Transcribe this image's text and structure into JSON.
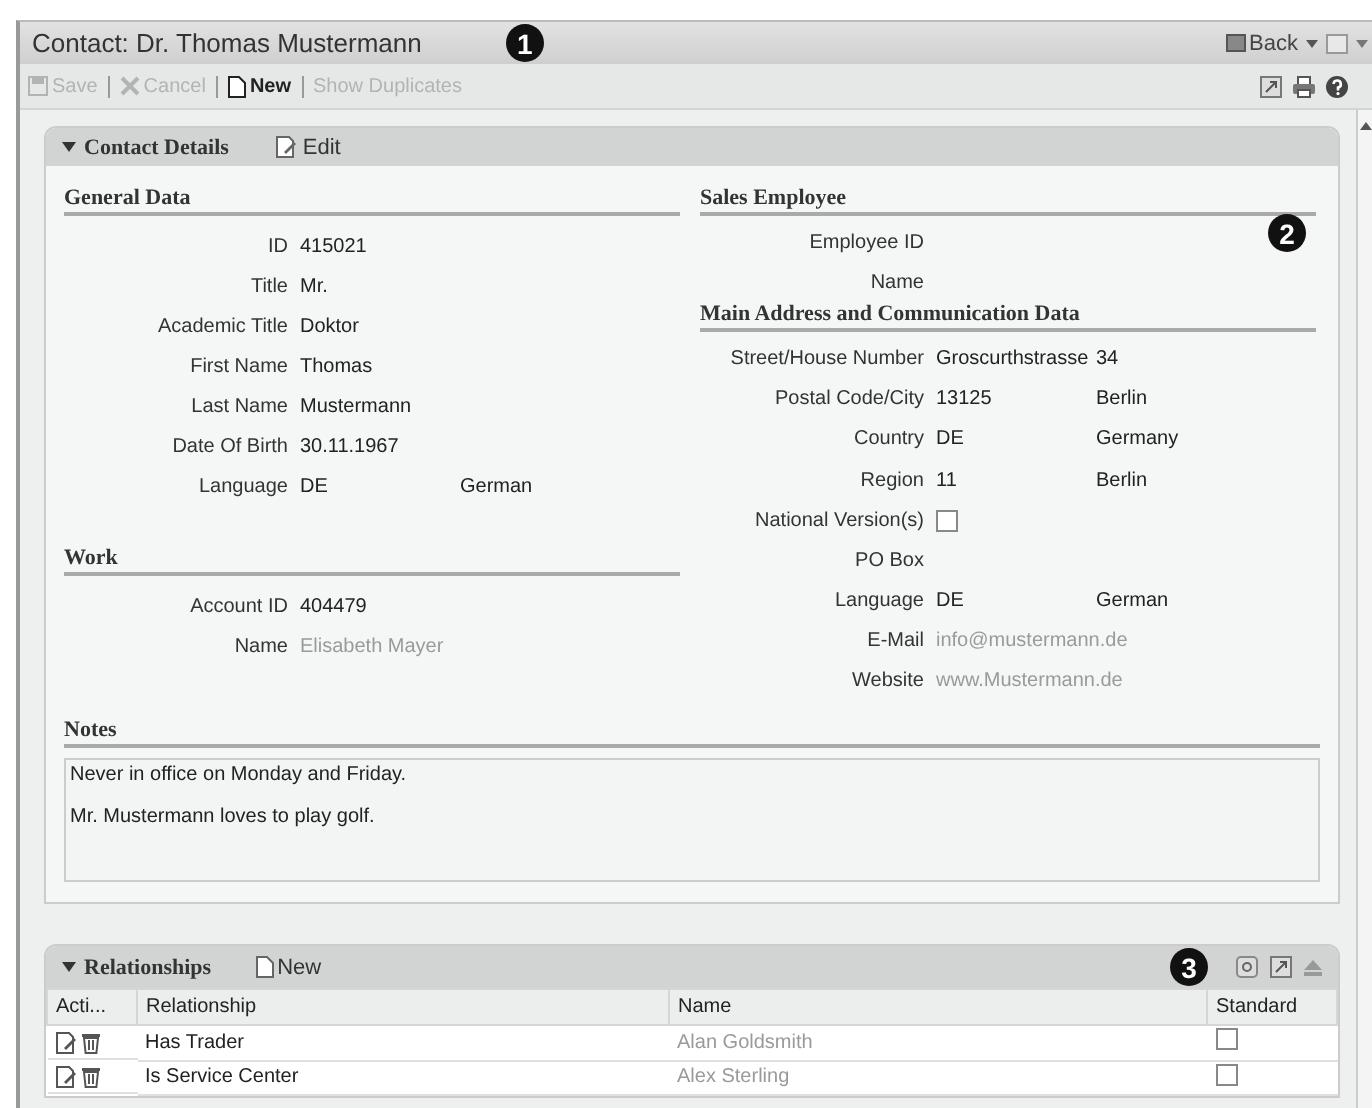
{
  "window": {
    "title": "Contact: Dr. Thomas Mustermann",
    "callout": "1",
    "back": "Back"
  },
  "toolbar": [
    {
      "label": "Save",
      "kind": "save",
      "disabled": true
    },
    {
      "label": "Cancel",
      "kind": "cancel",
      "disabled": true
    },
    {
      "label": "New",
      "kind": "new",
      "disabled": false
    },
    {
      "label": "Show Duplicates",
      "kind": "plain",
      "disabled": true
    }
  ],
  "contact_details": {
    "title": "Contact Details",
    "expanded": true,
    "edit": "Edit",
    "callout": "2",
    "general": {
      "heading": "General Data",
      "fields": [
        {
          "label": "ID",
          "value": "415021"
        },
        {
          "label": "Title",
          "value": "Mr."
        },
        {
          "label": "Academic Title",
          "value": "Doktor"
        },
        {
          "label": "First Name",
          "value": "Thomas"
        },
        {
          "label": "Last Name",
          "value": "Mustermann"
        },
        {
          "label": "Date Of Birth",
          "value": "30.11.1967"
        },
        {
          "label": "Language",
          "value": "DE",
          "value_2": "German"
        }
      ]
    },
    "work": {
      "heading": "Work",
      "fields": [
        {
          "label": "Account ID",
          "value": "404479"
        },
        {
          "label": "Name",
          "value": "Elisabeth Mayer",
          "kind": "link"
        }
      ]
    },
    "sales": {
      "heading": "Sales Employee",
      "fields": [
        {
          "label": "Employee ID"
        },
        {
          "label": "Name"
        }
      ]
    },
    "address": {
      "heading": "Main Address and Communication Data",
      "fields": [
        {
          "label": "Street/House Number",
          "value": "Groscurthstrasse",
          "value_2": "34"
        },
        {
          "label": "Postal Code/City",
          "value": "13125",
          "value_2": "Berlin"
        },
        {
          "label": "Country",
          "value": "DE",
          "value_2": "Germany"
        },
        {
          "label": "Region",
          "value": "11",
          "value_2": "Berlin"
        },
        {
          "label": "National Version(s)",
          "kind": "checkbox",
          "checked": false
        },
        {
          "label": "PO Box"
        },
        {
          "label": "Language",
          "value": "DE",
          "value_2": "German"
        },
        {
          "label": "E-Mail",
          "value": "info@mustermann.de",
          "kind": "link"
        },
        {
          "label": "Website",
          "value": "www.Mustermann.de",
          "kind": "link"
        }
      ]
    },
    "notes": {
      "heading": "Notes",
      "lines": [
        "Never in office on Monday and Friday.",
        "Mr. Mustermann loves to play golf."
      ]
    }
  },
  "relationships": {
    "title": "Relationships",
    "new": "New",
    "callout": "3",
    "columns": [
      "Acti...",
      "Relationship",
      "Name",
      "Standard"
    ],
    "rows": [
      {
        "relationship": "Has Trader",
        "name": "Alan Goldsmith",
        "standard": false
      },
      {
        "relationship": "Is Service Center",
        "name": "Alex Sterling",
        "standard": false
      }
    ]
  }
}
